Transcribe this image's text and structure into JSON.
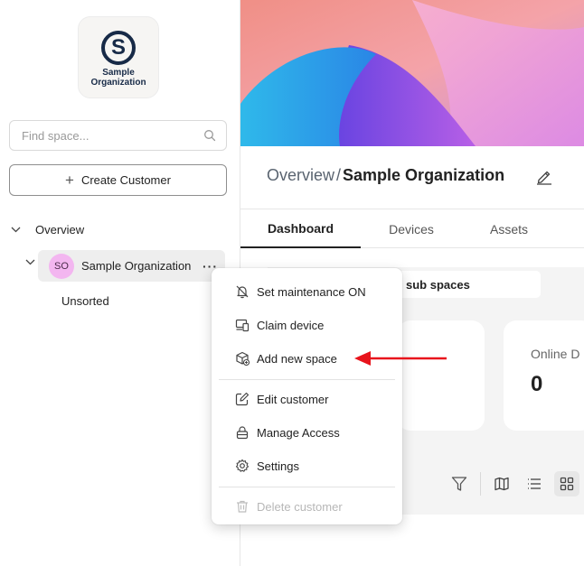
{
  "sidebar": {
    "logo": {
      "line1": "Sample",
      "line2": "Organization",
      "letter": "S",
      "color": "#172a47"
    },
    "search": {
      "placeholder": "Find space...",
      "value": ""
    },
    "create_button": {
      "icon": "plus-icon",
      "label": "Create Customer"
    },
    "tree": {
      "overview_label": "Overview",
      "org": {
        "avatar": "SO",
        "name": "Sample Organization",
        "more": "···"
      },
      "unsorted_label": "Unsorted"
    }
  },
  "main": {
    "breadcrumb": {
      "parent": "Overview",
      "separator": "/",
      "current": "Sample Organization"
    },
    "tabs": [
      {
        "label": "Dashboard",
        "active": true
      },
      {
        "label": "Devices",
        "active": false
      },
      {
        "label": "Assets",
        "active": false
      }
    ],
    "subspaces_label": "sub spaces",
    "stat_card": {
      "label": "Online D",
      "value": "0"
    }
  },
  "context_menu": {
    "items": [
      {
        "label": "Set maintenance ON",
        "icon": "bell-off-icon"
      },
      {
        "label": "Claim device",
        "icon": "devices-icon"
      },
      {
        "label": "Add new space",
        "icon": "cube-plus-icon"
      },
      {
        "label": "Edit customer",
        "icon": "edit-icon"
      },
      {
        "label": "Manage Access",
        "icon": "lock-icon"
      },
      {
        "label": "Settings",
        "icon": "gear-icon"
      },
      {
        "label": "Delete customer",
        "icon": "trash-icon",
        "disabled": true
      }
    ]
  },
  "colors": {
    "accent_avatar": "#f3b6f0",
    "arrow": "#e8141c",
    "text": "#222222"
  }
}
